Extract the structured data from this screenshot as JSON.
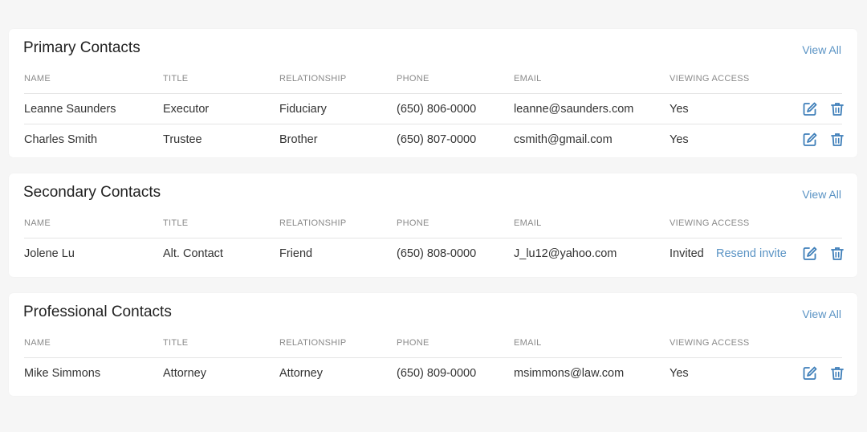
{
  "columns": [
    "NAME",
    "TITLE",
    "RELATIONSHIP",
    "PHONE",
    "EMAIL",
    "VIEWING ACCESS"
  ],
  "view_all_label": "View All",
  "accent_color": "#3f7fb9",
  "sections": [
    {
      "title": "Primary Contacts",
      "rows": [
        {
          "name": "Leanne Saunders",
          "title": "Executor",
          "relationship": "Fiduciary",
          "phone": "(650) 806-0000",
          "email": "leanne@saunders.com",
          "access": "Yes"
        },
        {
          "name": "Charles Smith",
          "title": "Trustee",
          "relationship": "Brother",
          "phone": "(650) 807-0000",
          "email": "csmith@gmail.com",
          "access": "Yes"
        }
      ]
    },
    {
      "title": "Secondary Contacts",
      "rows": [
        {
          "name": "Jolene Lu",
          "title": "Alt. Contact",
          "relationship": "Friend",
          "phone": "(650) 808-0000",
          "email": "J_lu12@yahoo.com",
          "access": "Invited",
          "resend": "Resend invite"
        }
      ]
    },
    {
      "title": "Professional Contacts",
      "rows": [
        {
          "name": "Mike Simmons",
          "title": "Attorney",
          "relationship": "Attorney",
          "phone": "(650) 809-0000",
          "email": "msimmons@law.com",
          "access": "Yes"
        }
      ]
    }
  ],
  "icons": {
    "edit": "edit-icon",
    "delete": "trash-icon"
  }
}
